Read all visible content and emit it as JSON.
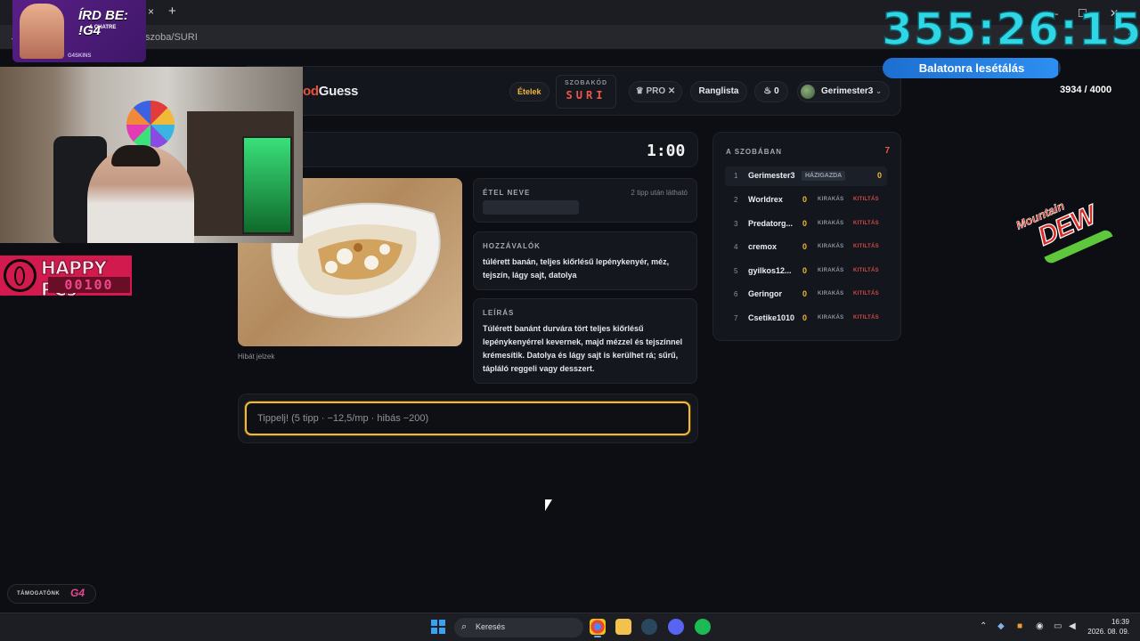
{
  "browser": {
    "url": "/szoba/SURI",
    "new_tab": "+",
    "tab_close": "×",
    "minimize": "—",
    "maximize": "☐",
    "close": "✕"
  },
  "app": {
    "logo_visible_part": "od",
    "logo_suffix": "Guess",
    "nav": {
      "etelek": "Ételek",
      "room_code_label": "SZOBAKÓD",
      "room_code": "SURI",
      "pro": "♛ PRO ✕",
      "ranglista": "Ranglista",
      "coins": "♨ 0",
      "username": "Gerimester3"
    },
    "timer": "1:00",
    "report_link": "Hibát jelzek",
    "dish_name": {
      "title": "ÉTEL NEVE",
      "hint": "2 tipp után látható"
    },
    "ingredients": {
      "title": "HOZZÁVALÓK",
      "text": "túlérett banán, teljes kiőrlésű lepénykenyér, méz, tejszín, lágy sajt, datolya"
    },
    "description": {
      "title": "LEÍRÁS",
      "text": "Túlérett banánt durvára tört teljes kiőrlésű lepénykenyérrel kevernek, majd mézzel és tejszínnel krémesítik. Datolya és lágy sajt is kerülhet rá; sűrű, tápláló reggeli vagy desszert."
    },
    "guess_placeholder": "Tippelj! (5 tipp · −12,5/mp · hibás −200)",
    "players": {
      "title": "A SZOBÁBAN",
      "count": "7",
      "host_badge": "HÁZIGAZDA",
      "kick_label": "KIRAKÁS",
      "ban_label": "KITILTÁS",
      "list": [
        {
          "rank": "1",
          "name": "Gerimester3",
          "score": "0"
        },
        {
          "rank": "2",
          "name": "Worldrex",
          "score": "0"
        },
        {
          "rank": "3",
          "name": "Predatorg...",
          "score": "0"
        },
        {
          "rank": "4",
          "name": "cremox",
          "score": "0"
        },
        {
          "rank": "5",
          "name": "gyilkos12...",
          "score": "0"
        },
        {
          "rank": "6",
          "name": "Geringor",
          "score": "0"
        },
        {
          "rank": "7",
          "name": "Csetike1010",
          "score": "0"
        }
      ]
    }
  },
  "overlay": {
    "ad_title": "ÍRD BE: !G4",
    "ad_sub": "A CHATRE",
    "ad_brand": "G4SKINS",
    "happy_text": "HAPPY PCs",
    "happy_number": "00100",
    "support_label": "TÁMOGATÓNK",
    "support_logo": "G4",
    "subathon_timer": "355:26:15",
    "goal_label": "Balatonra lesétálás",
    "goal_progress": 0.9835,
    "goal_count": "3934 / 4000",
    "sponsor_top": "Mountain",
    "sponsor_main": "DEW"
  },
  "taskbar": {
    "search_label": "Keresés",
    "time": "16:39",
    "date": "2026. 08. 09.",
    "apps": [
      "chrome-icon",
      "folder-icon",
      "steam-icon",
      "discord-icon",
      "spotify-icon"
    ]
  },
  "colors": {
    "accent_gold": "#f0b93a",
    "accent_red": "#f0574a",
    "timer_cyan": "#2fd6e6",
    "goal_blue": "#1d6fd0"
  }
}
